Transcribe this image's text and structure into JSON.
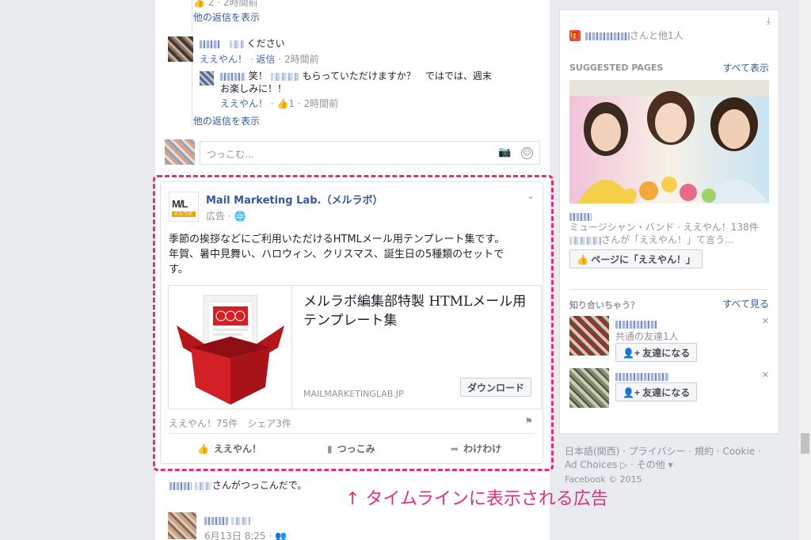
{
  "thread": {
    "more_replies_1": "他の返信を表示",
    "comment1_suffix": "ください",
    "comment1_like": "ええやん！",
    "comment1_reply": "返信",
    "comment1_time": "2時間前",
    "reply1_text": "笑！",
    "reply1_text2": "もらっていただけますか？　ではでは、週末",
    "reply1_text3": "お楽しみに！！",
    "reply1_like": "ええやん！",
    "reply1_likes": "1",
    "reply1_time": "2時間前",
    "more_replies_2": "他の返信を表示",
    "top_time": "2時間前",
    "top_count": "2",
    "composer_placeholder": "つっこむ..."
  },
  "ad": {
    "page_name": "Mail Marketing Lab.（メルラボ）",
    "sponsored": "広告 ·",
    "body_line1": "季節の挨拶などにご利用いただけるHTMLメール用テンプレート集です。",
    "body_line2": "年賀、暑中見舞い、ハロウィン、クリスマス、誕生日の5種類のセットで",
    "body_line3": "す。",
    "link_title": "メルラボ編集部特製 HTMLメール用テンプレート集",
    "link_domain": "MAILMARKETINGLAB.JP",
    "download_label": "ダウンロード",
    "stats": "ええやん！75件　シェア3件",
    "action_like": "ええやん！",
    "action_comment": "つっこみ",
    "action_share": "わけわけ",
    "logo_text": "M/L",
    "logo_sub": "メルラボ"
  },
  "bottom_story": {
    "header_suffix": "さんがつっこんだで。",
    "date": "6月13日 8:25 ·"
  },
  "caption": "↑ タイムラインに表示される広告",
  "right_column": {
    "friend_and_others": "さんと他1人",
    "suggested_title": "SUGGESTED PAGES",
    "see_all": "すべて表示",
    "page_category": "ミュージシャン・バンド · ええやん！138件",
    "page_liked_by": "さんが「ええやん！」て言う...",
    "like_page_button": "ページに「ええやん！」",
    "pymk_title": "知り合いちゃう？",
    "pymk_see_all": "すべて見る",
    "mutual_friends": "共通の友達1人",
    "add_friend": "友達になる",
    "add_friend_2": "友達になる"
  },
  "footer": {
    "links_line1": "日本語(関西) · プライバシー · 規約 · Cookie ·",
    "links_line2": "Ad Choices ▷ · その他 ▾",
    "copyright": "Facebook © 2015"
  },
  "colors": {
    "link_blue": "#365899",
    "accent_pink": "#e0307c",
    "ad_red": "#d32027"
  }
}
